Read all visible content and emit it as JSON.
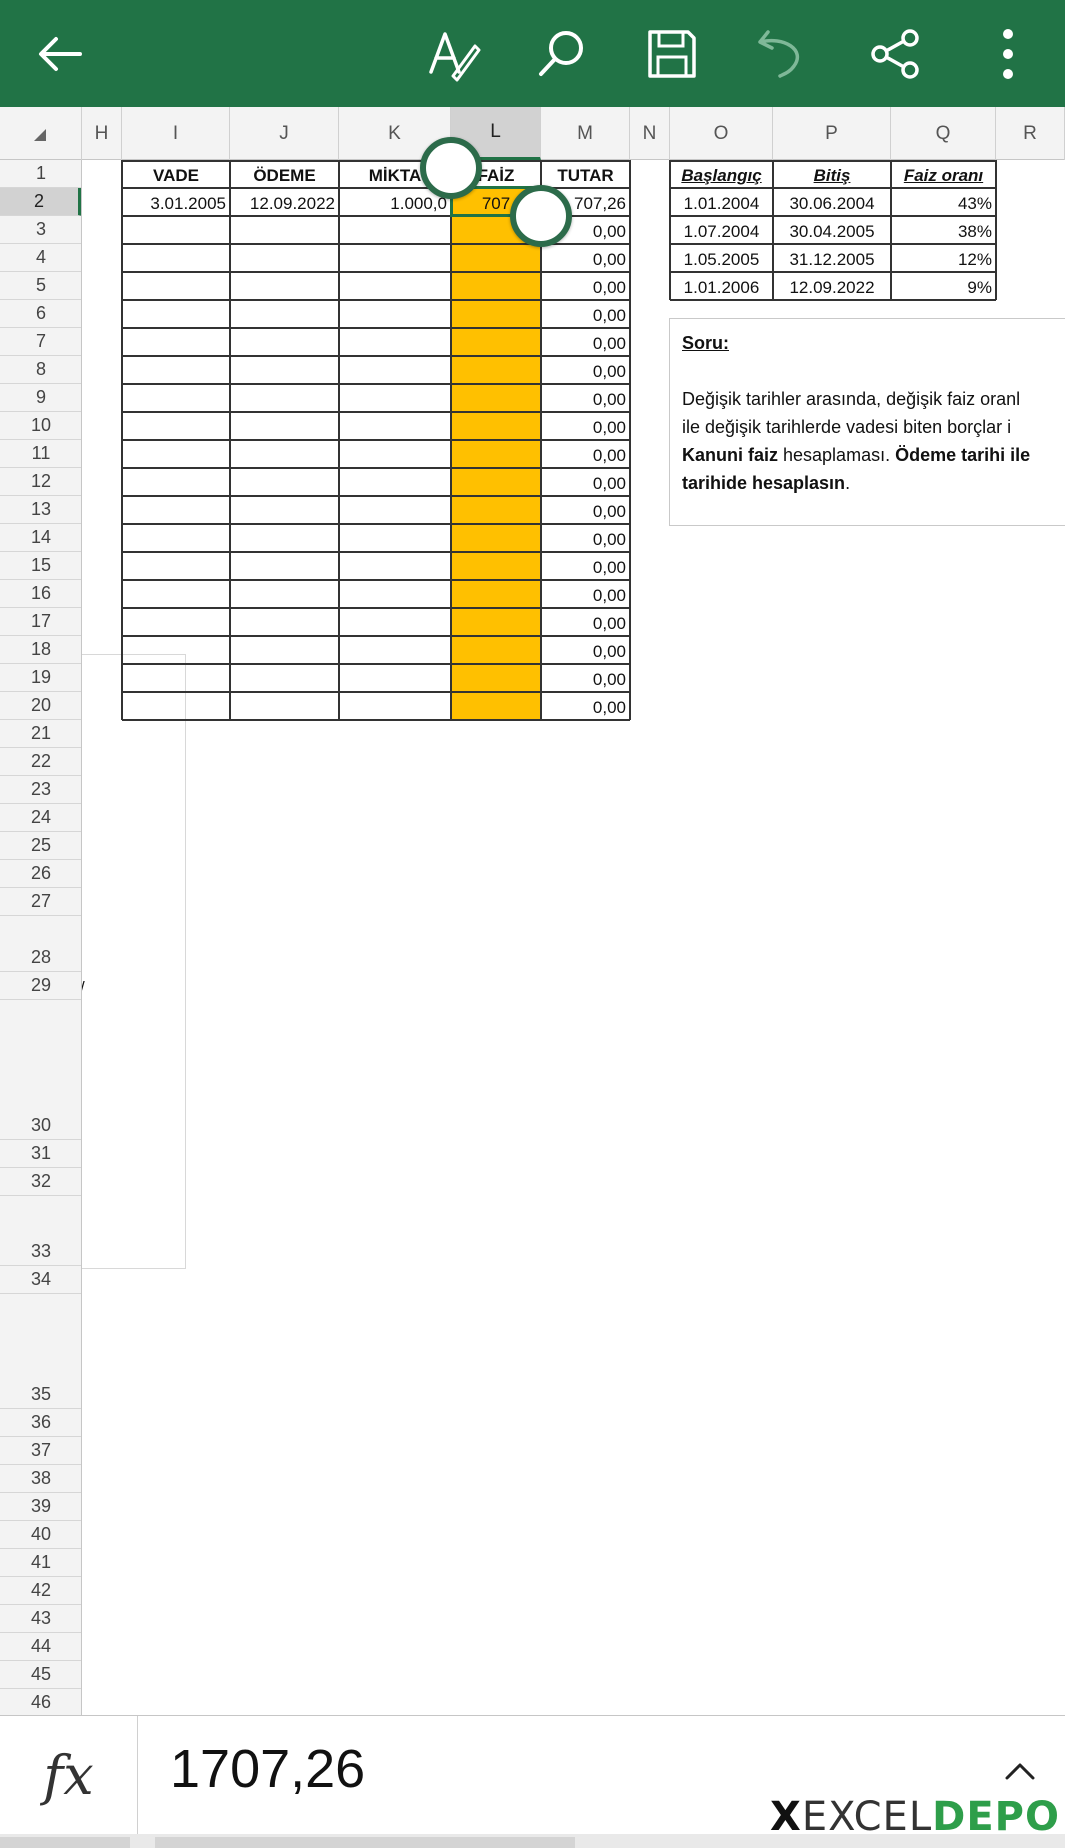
{
  "toolbar": {
    "back": "back-arrow-icon",
    "draw": "draw-pen-icon",
    "search": "search-icon",
    "save": "save-icon",
    "undo": "undo-icon",
    "share": "share-icon",
    "more": "more-vertical-icon",
    "color": "#217346"
  },
  "columns": [
    "H",
    "I",
    "J",
    "K",
    "L",
    "M",
    "N",
    "O",
    "P",
    "Q",
    "R"
  ],
  "selected_column": "L",
  "rows": [
    "1",
    "2",
    "3",
    "4",
    "5",
    "6",
    "7",
    "8",
    "9",
    "10",
    "11",
    "12",
    "13",
    "14",
    "15",
    "16",
    "17",
    "18",
    "19",
    "20",
    "21",
    "22",
    "23",
    "24",
    "25",
    "26",
    "27",
    "28",
    "29",
    "30",
    "31",
    "32",
    "33",
    "34",
    "35",
    "36",
    "37",
    "38",
    "39",
    "40",
    "41",
    "42",
    "43",
    "44",
    "45",
    "46"
  ],
  "selected_row": "2",
  "table": {
    "headers": [
      "VADE",
      "ÖDEME",
      "MİKTA",
      "FAİZ",
      "TUTAR"
    ],
    "row2": {
      "vade": "3.01.2005",
      "odeme": "12.09.2022",
      "miktar": "1.000,0",
      "faiz": "707",
      "tutar": "707,26"
    },
    "tutar_empty": "0,00",
    "highlight_color": "#ffc000"
  },
  "rates": {
    "headers": [
      "Başlangıç",
      "Bitiş",
      "Faiz oranı"
    ],
    "rows": [
      [
        "1.01.2004",
        "30.06.2004",
        "43%"
      ],
      [
        "1.07.2004",
        "30.04.2005",
        "38%"
      ],
      [
        "1.05.2005",
        "31.12.2005",
        "12%"
      ],
      [
        "1.01.2006",
        "12.09.2022",
        "9%"
      ]
    ]
  },
  "question": {
    "label": "Soru:",
    "line1": "Değişik tarihler arasında, değişik faiz oranl",
    "line2": "ile değişik tarihlerde vadesi biten borçlar i",
    "line3_bold1": "Kanuni faiz",
    "line3_mid": " hesaplaması. ",
    "line3_bold2": "Ödeme tarihi ile",
    "line4_bold": "tarihide hesaplasın",
    "line4_end": "."
  },
  "stray_char": "/",
  "formula_bar": {
    "fx_label": "fx",
    "value": "1707,26",
    "expand": "chevron-up-icon"
  },
  "watermark": {
    "x": "X",
    "excel": "EXCEL",
    "depo": "DEPO"
  }
}
